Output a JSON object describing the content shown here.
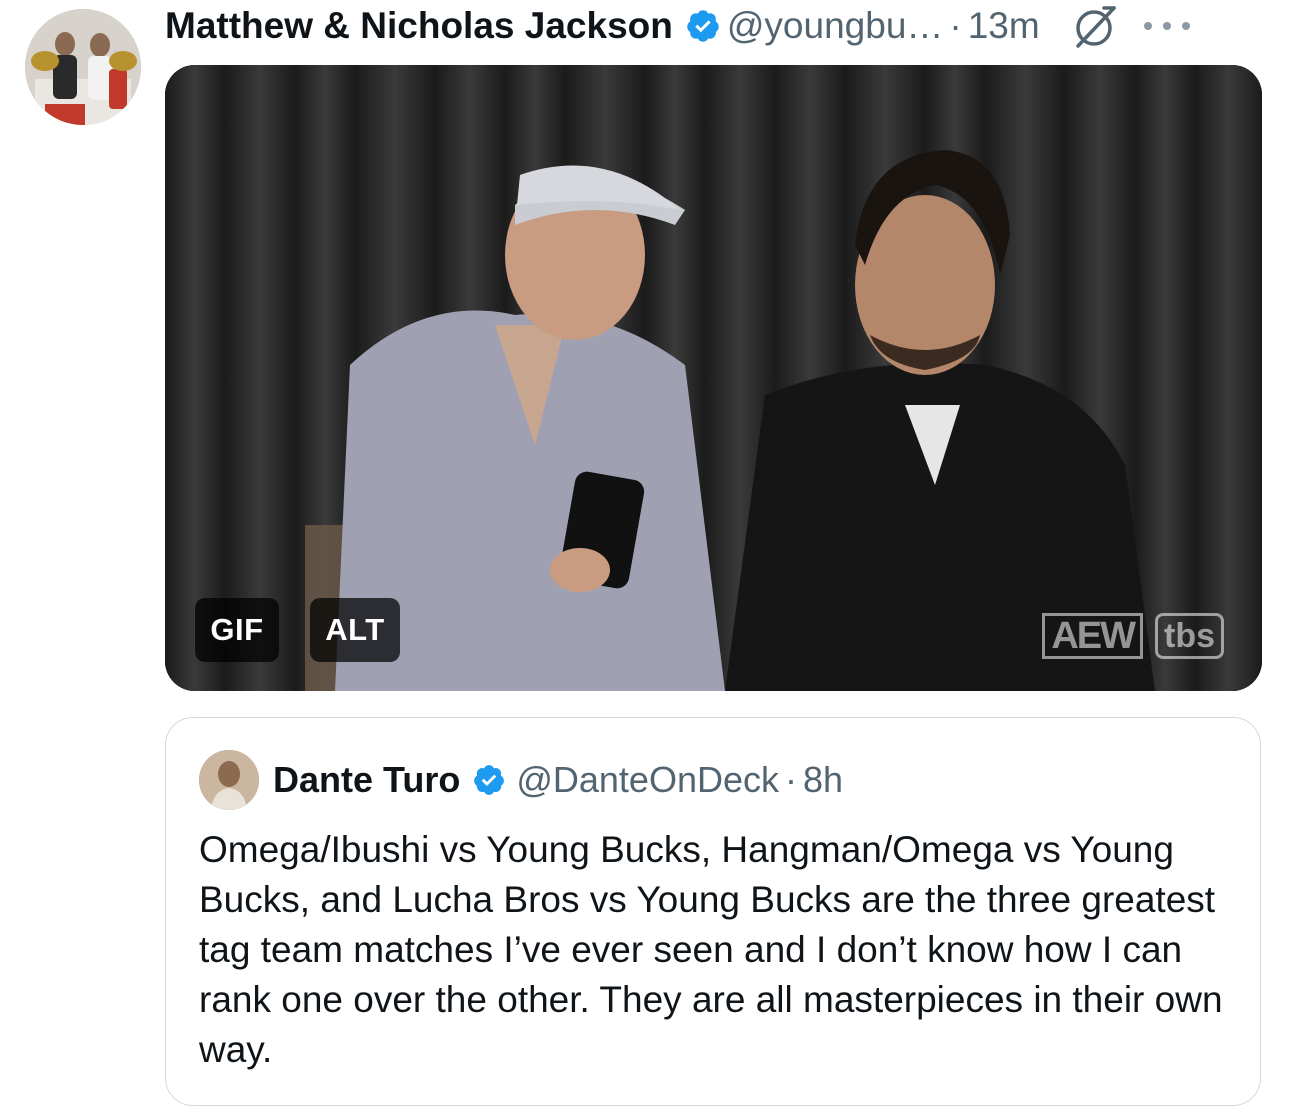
{
  "tweet": {
    "author_name": "Matthew & Nicholas Jackson",
    "handle": "@youngbu…",
    "separator": "·",
    "time": "13m",
    "icons": {
      "verified": "verified-badge-icon",
      "nuzzel": "nuzzel-icon",
      "more": "more-options-icon"
    },
    "media": {
      "badge_gif": "GIF",
      "badge_alt": "ALT",
      "watermark_aew": "AEW",
      "watermark_tbs": "tbs"
    }
  },
  "quoted_tweet": {
    "author_name": "Dante Turo",
    "handle": "@DanteOnDeck",
    "separator": "·",
    "time": "8h",
    "text": "Omega/Ibushi vs Young Bucks, Hangman/Omega vs Young Bucks, and Lucha Bros vs Young Bucks are the three greatest tag team matches I’ve ever seen and I don’t know how I can rank one over the other. They are all masterpieces in their own way."
  },
  "colors": {
    "verified_blue": "#1d9bf0",
    "secondary_text": "#536471",
    "border": "#cfd9de"
  }
}
